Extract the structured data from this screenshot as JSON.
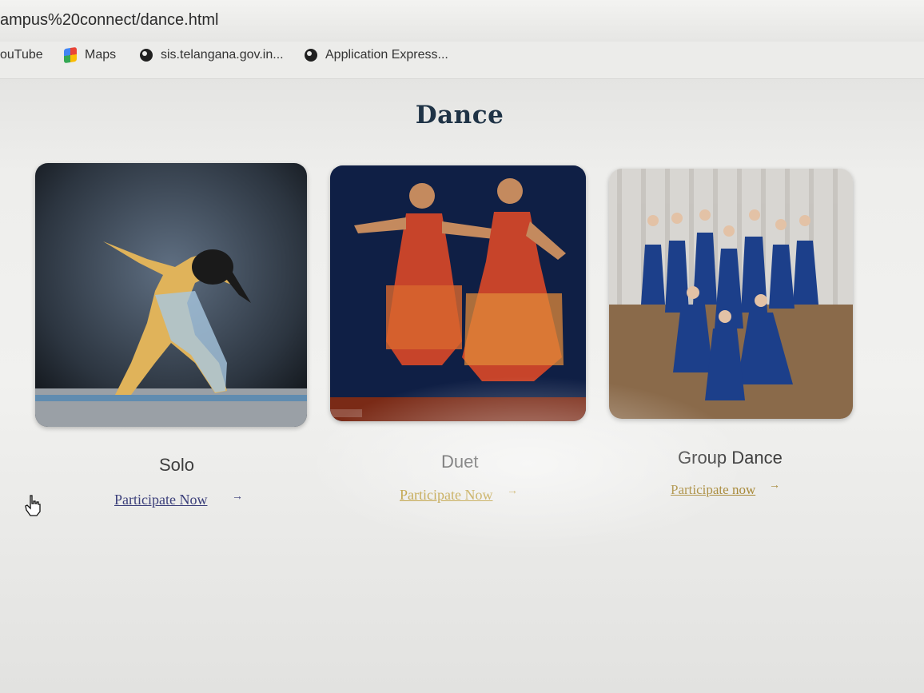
{
  "browser": {
    "address": "ampus%20connect/dance.html",
    "bookmarks": [
      {
        "label": "ouTube",
        "icon": "youtube-icon"
      },
      {
        "label": "Maps",
        "icon": "maps-icon"
      },
      {
        "label": "sis.telangana.gov.in...",
        "icon": "globe-icon"
      },
      {
        "label": "Application Express...",
        "icon": "globe-icon"
      }
    ]
  },
  "page": {
    "title": "Dance",
    "cards": [
      {
        "label": "Solo",
        "link": "Participate Now",
        "link_color": "#3b3f7a",
        "arrow": "→"
      },
      {
        "label": "Duet",
        "link": "Participate Now",
        "link_color": "#b8962e",
        "arrow": "→"
      },
      {
        "label": "Group Dance",
        "link": "Participate now",
        "link_color": "#a88a3a",
        "arrow": "→"
      }
    ]
  },
  "colors": {
    "title": "#1f3346"
  }
}
